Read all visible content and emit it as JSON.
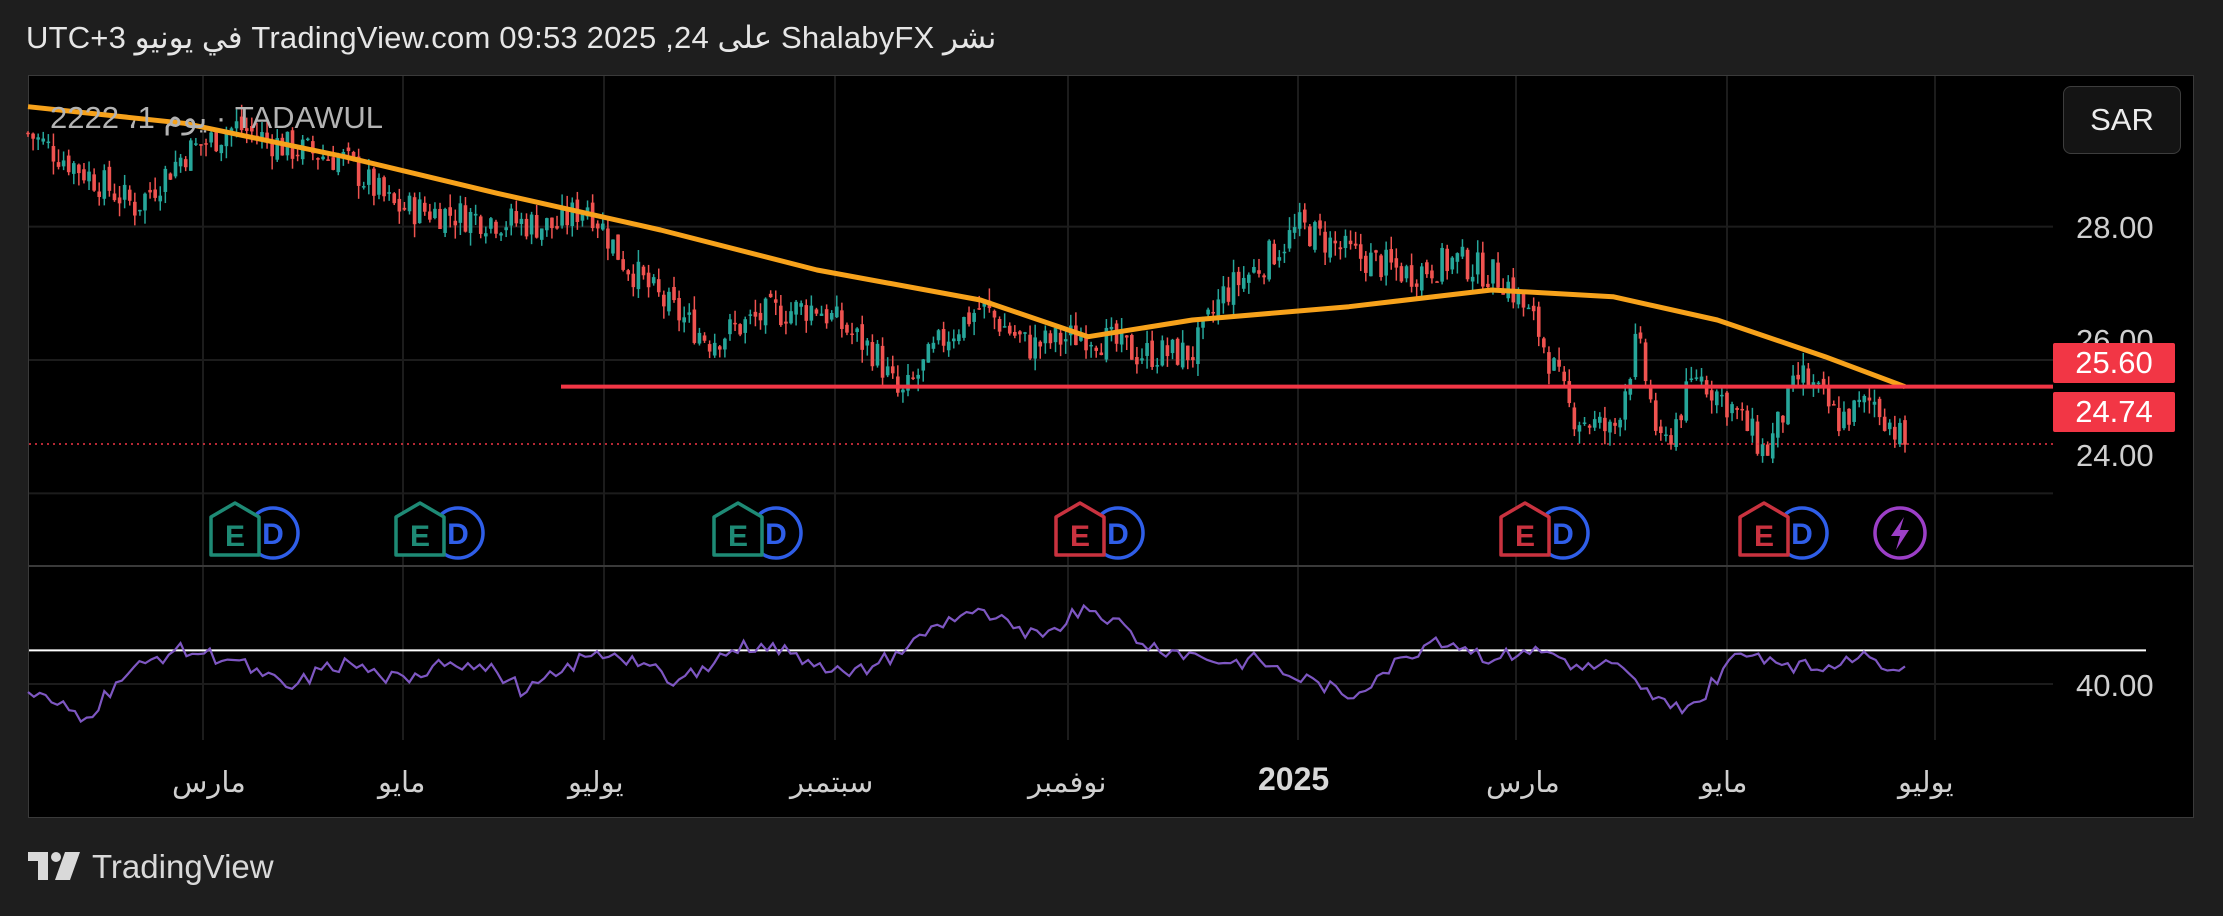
{
  "header": {
    "text": "نشر ShalabyFX على TradingView.com 09:53 2025 ,24 في يونيو UTC+3"
  },
  "symbol": {
    "label": "2222 ،1 يوم · TADAWUL"
  },
  "currency_button": {
    "label": "SAR"
  },
  "price_axis": {
    "ticks": [
      "28.00",
      "26.00",
      "24.00"
    ],
    "resistance_tag": "25.60",
    "last_price_tag": "24.74",
    "rsi_tick": "40.00"
  },
  "time_axis": {
    "labels": [
      "مارس",
      "مايو",
      "يوليو",
      "سبتمبر",
      "نوفمبر",
      "2025",
      "مارس",
      "مايو",
      "يوليو"
    ]
  },
  "events": [
    {
      "type": "E",
      "tone": "green",
      "dividend": true
    },
    {
      "type": "E",
      "tone": "green",
      "dividend": true
    },
    {
      "type": "E",
      "tone": "green",
      "dividend": true
    },
    {
      "type": "E",
      "tone": "red",
      "dividend": true
    },
    {
      "type": "E",
      "tone": "red",
      "dividend": true
    },
    {
      "type": "E",
      "tone": "red",
      "dividend": true
    },
    {
      "type": "split-bolt",
      "tone": "purple",
      "dividend": false
    }
  ],
  "chart_data": {
    "type": "candlestick",
    "price_axis": {
      "ylim": [
        23.0,
        30.2
      ],
      "ticks": [
        28.0,
        26.0,
        24.0
      ]
    },
    "moving_average": [
      {
        "x": "2024-01-01",
        "y": 29.8
      },
      {
        "x": "2024-02-15",
        "y": 29.55
      },
      {
        "x": "2024-04-01",
        "y": 29.05
      },
      {
        "x": "2024-05-15",
        "y": 28.5
      },
      {
        "x": "2024-07-01",
        "y": 27.95
      },
      {
        "x": "2024-08-15",
        "y": 27.35
      },
      {
        "x": "2024-10-01",
        "y": 26.9
      },
      {
        "x": "2024-11-01",
        "y": 26.35
      },
      {
        "x": "2024-12-01",
        "y": 26.6
      },
      {
        "x": "2025-01-15",
        "y": 26.8
      },
      {
        "x": "2025-02-25",
        "y": 27.05
      },
      {
        "x": "2025-04-01",
        "y": 26.95
      },
      {
        "x": "2025-05-01",
        "y": 26.6
      },
      {
        "x": "2025-06-01",
        "y": 26.05
      },
      {
        "x": "2025-06-24",
        "y": 25.6
      }
    ],
    "resistance_line": 25.6,
    "last_price": 24.74,
    "close_series": [
      {
        "x": "2024-01-01",
        "y": 29.4
      },
      {
        "x": "2024-01-15",
        "y": 28.9
      },
      {
        "x": "2024-02-01",
        "y": 28.3
      },
      {
        "x": "2024-02-15",
        "y": 29.1
      },
      {
        "x": "2024-03-01",
        "y": 29.5
      },
      {
        "x": "2024-03-15",
        "y": 29.2
      },
      {
        "x": "2024-04-01",
        "y": 29.0
      },
      {
        "x": "2024-04-15",
        "y": 28.3
      },
      {
        "x": "2024-05-01",
        "y": 28.2
      },
      {
        "x": "2024-05-15",
        "y": 28.1
      },
      {
        "x": "2024-06-01",
        "y": 28.0
      },
      {
        "x": "2024-06-10",
        "y": 28.35
      },
      {
        "x": "2024-06-20",
        "y": 27.5
      },
      {
        "x": "2024-07-01",
        "y": 26.9
      },
      {
        "x": "2024-07-15",
        "y": 26.3
      },
      {
        "x": "2024-08-01",
        "y": 26.7
      },
      {
        "x": "2024-08-15",
        "y": 26.8
      },
      {
        "x": "2024-09-01",
        "y": 26.1
      },
      {
        "x": "2024-09-08",
        "y": 25.4
      },
      {
        "x": "2024-09-20",
        "y": 26.3
      },
      {
        "x": "2024-10-01",
        "y": 26.8
      },
      {
        "x": "2024-10-15",
        "y": 26.2
      },
      {
        "x": "2024-11-01",
        "y": 26.4
      },
      {
        "x": "2024-11-15",
        "y": 26.1
      },
      {
        "x": "2024-12-01",
        "y": 26.1
      },
      {
        "x": "2024-12-10",
        "y": 27.0
      },
      {
        "x": "2024-12-20",
        "y": 27.4
      },
      {
        "x": "2025-01-01",
        "y": 28.0
      },
      {
        "x": "2025-01-15",
        "y": 27.6
      },
      {
        "x": "2025-02-01",
        "y": 27.3
      },
      {
        "x": "2025-02-15",
        "y": 27.5
      },
      {
        "x": "2025-03-01",
        "y": 27.2
      },
      {
        "x": "2025-03-10",
        "y": 26.5
      },
      {
        "x": "2025-03-20",
        "y": 25.2
      },
      {
        "x": "2025-04-01",
        "y": 24.9
      },
      {
        "x": "2025-04-08",
        "y": 26.3
      },
      {
        "x": "2025-04-15",
        "y": 24.6
      },
      {
        "x": "2025-04-25",
        "y": 25.8
      },
      {
        "x": "2025-05-05",
        "y": 25.3
      },
      {
        "x": "2025-05-15",
        "y": 24.6
      },
      {
        "x": "2025-05-25",
        "y": 25.8
      },
      {
        "x": "2025-06-05",
        "y": 25.1
      },
      {
        "x": "2025-06-15",
        "y": 25.4
      },
      {
        "x": "2025-06-24",
        "y": 24.74
      }
    ],
    "rsi": {
      "level_line": 48,
      "values": [
        35,
        31,
        27,
        38,
        44,
        48,
        47,
        45,
        40,
        36,
        42,
        44,
        40,
        38,
        45,
        44,
        41,
        35,
        40,
        46,
        47,
        44,
        37,
        43,
        48,
        50,
        47,
        44,
        40,
        44,
        49,
        56,
        60,
        58,
        52,
        55,
        62,
        58,
        50,
        48,
        46,
        44,
        45,
        40,
        38,
        33,
        40,
        46,
        52,
        49,
        45,
        48,
        47,
        42,
        44,
        36,
        30,
        32,
        45,
        47,
        44,
        42,
        46,
        45,
        43
      ]
    },
    "xlabels": [
      "مارس",
      "مايو",
      "يوليو",
      "سبتمبر",
      "نوفمبر",
      "2025",
      "مارس",
      "مايو",
      "يوليو"
    ],
    "colors": {
      "up": "#26a69a",
      "down": "#ef5350",
      "ma": "#f7a21b",
      "resistance": "#f23645",
      "rsi": "#7e57c2",
      "rsi_level": "#ffffff"
    }
  },
  "footer": {
    "brand": "TradingView"
  }
}
